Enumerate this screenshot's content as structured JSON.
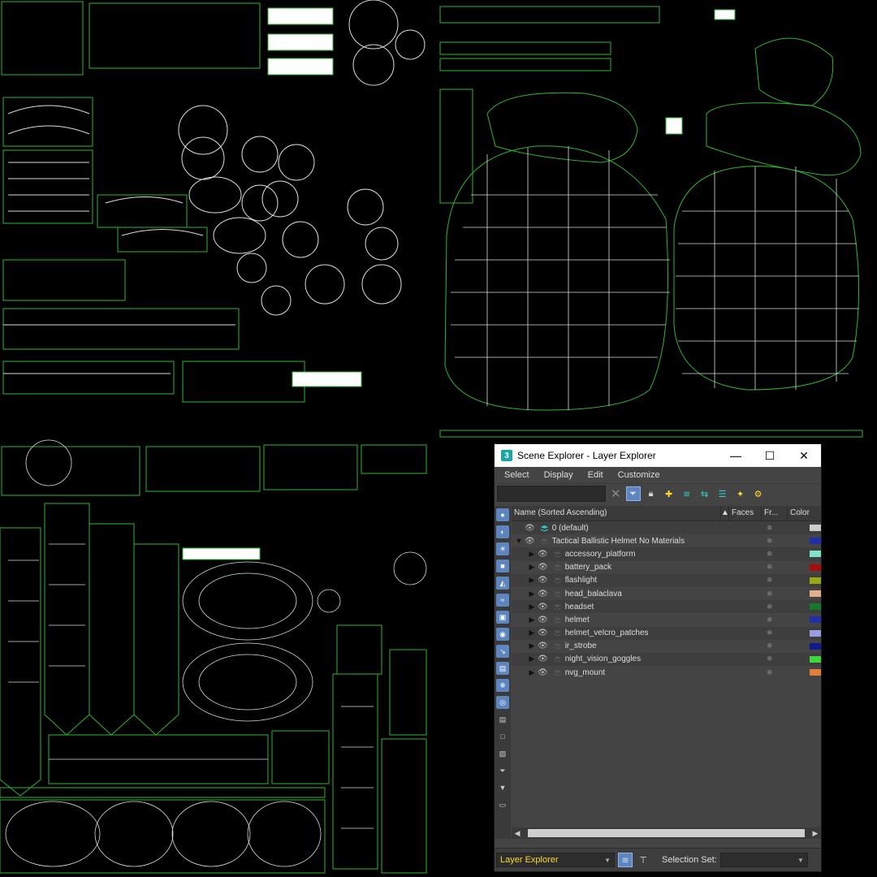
{
  "window": {
    "app_icon": "3",
    "title": "Scene Explorer - Layer Explorer",
    "buttons": {
      "minimize": "—",
      "maximize": "☐",
      "close": "✕"
    }
  },
  "menu": [
    "Select",
    "Display",
    "Edit",
    "Customize"
  ],
  "search": {
    "value": "",
    "placeholder": ""
  },
  "columns": {
    "name": "Name (Sorted Ascending)",
    "sort_indicator": "▲",
    "faces": "Faces",
    "frozen": "Fr...",
    "color": "Color"
  },
  "rows": [
    {
      "label": "0 (default)",
      "color": "#cccccc",
      "level": 0,
      "expander": ""
    },
    {
      "label": "Tactical Ballistic Helmet No Materials",
      "color": "#1f2fa8",
      "level": 0,
      "expander": "▼"
    },
    {
      "label": "accessory_platform",
      "color": "#7fe0c8",
      "level": 1,
      "expander": "▶"
    },
    {
      "label": "battery_pack",
      "color": "#a80c0c",
      "level": 1,
      "expander": "▶"
    },
    {
      "label": "flashlight",
      "color": "#9aa812",
      "level": 1,
      "expander": "▶"
    },
    {
      "label": "head_balaclava",
      "color": "#e4b08a",
      "level": 1,
      "expander": "▶"
    },
    {
      "label": "headset",
      "color": "#127a2a",
      "level": 1,
      "expander": "▶"
    },
    {
      "label": "helmet",
      "color": "#2030a8",
      "level": 1,
      "expander": "▶"
    },
    {
      "label": "helmet_velcro_patches",
      "color": "#9c9ce0",
      "level": 1,
      "expander": "▶"
    },
    {
      "label": "ir_strobe",
      "color": "#101a8a",
      "level": 1,
      "expander": "▶"
    },
    {
      "label": "night_vision_goggles",
      "color": "#3ed83e",
      "level": 1,
      "expander": "▶"
    },
    {
      "label": "nvg_mount",
      "color": "#e0803a",
      "level": 1,
      "expander": "▶"
    }
  ],
  "statusbar": {
    "explorer": "Layer Explorer",
    "selection_label": "Selection Set:",
    "selection_value": ""
  },
  "icons": [
    "funnel-icon",
    "lock-icon",
    "add-layer-icon",
    "layers-icon",
    "move-icon",
    "stack-icon",
    "highlight-icon",
    "settings-icon"
  ],
  "colors": {
    "accent": "#5d86c0",
    "uv_line": "#2fb52f",
    "uv_grid": "#cfcfcf"
  }
}
